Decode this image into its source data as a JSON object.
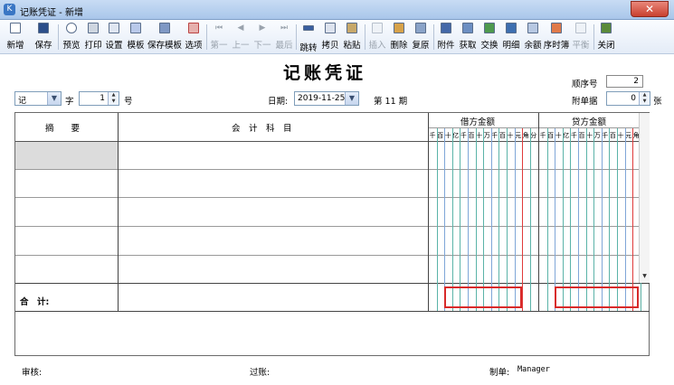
{
  "window": {
    "title": "记账凭证 - 新增",
    "close_label": "✕"
  },
  "toolbar": {
    "buttons": [
      {
        "label": "新增",
        "icon": "new-icon",
        "enabled": true
      },
      {
        "label": "保存",
        "icon": "save-icon",
        "enabled": true
      },
      {
        "label": "预览",
        "icon": "preview-icon",
        "enabled": true
      },
      {
        "label": "打印",
        "icon": "print-icon",
        "enabled": true
      },
      {
        "label": "设置",
        "icon": "settings-icon",
        "enabled": true
      },
      {
        "label": "模板",
        "icon": "template-icon",
        "enabled": true
      },
      {
        "label": "保存模板",
        "icon": "save-template-icon",
        "enabled": true
      },
      {
        "label": "选项",
        "icon": "options-icon",
        "enabled": true
      },
      {
        "label": "第一",
        "icon": "first-icon",
        "enabled": false
      },
      {
        "label": "上一",
        "icon": "prev-icon",
        "enabled": false
      },
      {
        "label": "下一",
        "icon": "next-icon",
        "enabled": false
      },
      {
        "label": "最后",
        "icon": "last-icon",
        "enabled": false
      },
      {
        "label": "跳转",
        "icon": "jump-icon",
        "enabled": true
      },
      {
        "label": "拷贝",
        "icon": "copy-icon",
        "enabled": true
      },
      {
        "label": "粘贴",
        "icon": "paste-icon",
        "enabled": true
      },
      {
        "label": "插入",
        "icon": "insert-icon",
        "enabled": false
      },
      {
        "label": "删除",
        "icon": "delete-icon",
        "enabled": true
      },
      {
        "label": "复原",
        "icon": "restore-icon",
        "enabled": true
      },
      {
        "label": "附件",
        "icon": "attachment-icon",
        "enabled": true
      },
      {
        "label": "获取",
        "icon": "fetch-icon",
        "enabled": true
      },
      {
        "label": "交换",
        "icon": "swap-icon",
        "enabled": true
      },
      {
        "label": "明细",
        "icon": "detail-icon",
        "enabled": true
      },
      {
        "label": "余额",
        "icon": "balance-icon",
        "enabled": true
      },
      {
        "label": "序时簿",
        "icon": "journal-icon",
        "enabled": true
      },
      {
        "label": "平衡",
        "icon": "level-icon",
        "enabled": false
      },
      {
        "label": "关闭",
        "icon": "close-icon",
        "enabled": true
      }
    ]
  },
  "voucher": {
    "title": "记账凭证",
    "seq_label": "顺序号",
    "seq_value": "2",
    "attach_label": "附单据",
    "attach_value": "0",
    "attach_unit": "张",
    "type_value": "记",
    "type_suffix": "字",
    "number_value": "1",
    "number_suffix": "号",
    "date_label": "日期:",
    "date_value": "2019-11-25",
    "period_label": "第 11 期"
  },
  "grid": {
    "col_summary": "摘　　要",
    "col_account": "会　计　科　目",
    "col_debit": "借方金额",
    "col_credit": "贷方金额",
    "digits": [
      "千",
      "百",
      "十",
      "亿",
      "千",
      "百",
      "十",
      "万",
      "千",
      "百",
      "十",
      "元",
      "角",
      "分"
    ],
    "total_label": "合　计:"
  },
  "footer": {
    "reviewer_label": "审核:",
    "poster_label": "过账:",
    "maker_label": "制单:",
    "maker_value": "Manager"
  }
}
